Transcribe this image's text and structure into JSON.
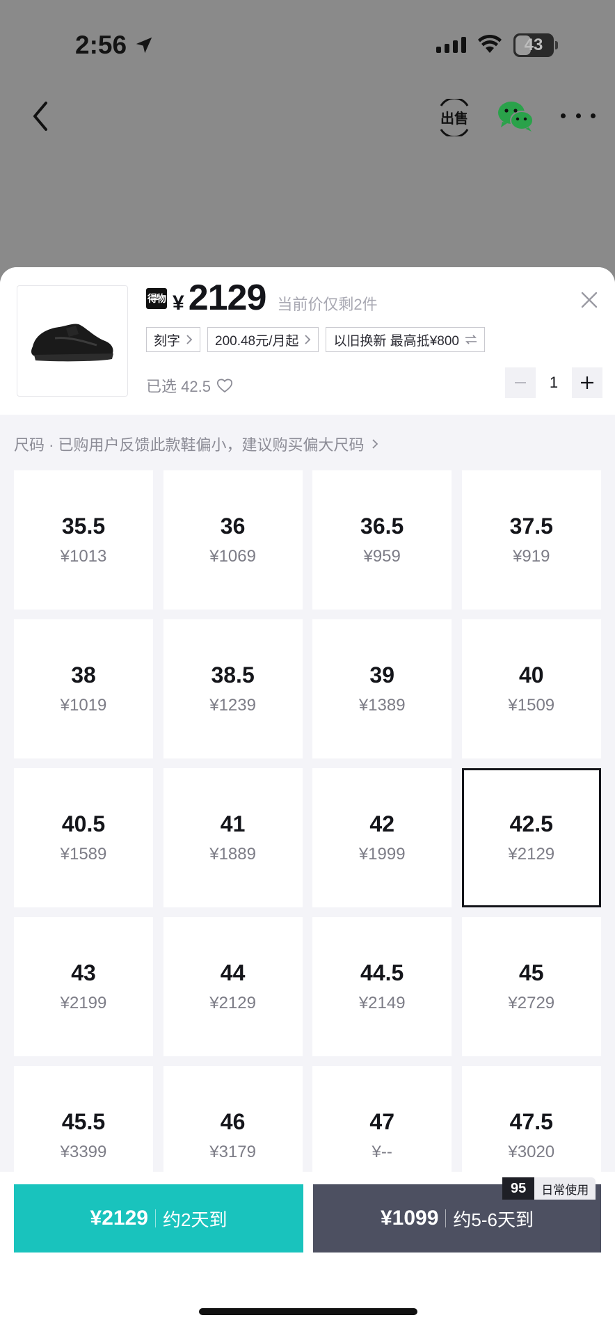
{
  "status_bar": {
    "time": "2:56",
    "battery": "43",
    "battery_level": 0.43
  },
  "nav": {
    "back": "back-icon",
    "sell_label": "出售",
    "share": "wechat-icon",
    "more": "more-icon"
  },
  "product": {
    "brand_badge": "得物",
    "currency": "¥",
    "price": "2129",
    "stock_note": "当前价仅剩2件",
    "tags": [
      {
        "label": "刻字",
        "chevron": true
      },
      {
        "label": "200.48元/月起",
        "chevron": true
      },
      {
        "label": "以旧换新 最高抵¥800",
        "chevron": false,
        "swap": true
      }
    ],
    "selected_text": "已选 42.5",
    "quantity": "1"
  },
  "size_hint": "尺码 · 已购用户反馈此款鞋偏小，建议购买偏大尺码",
  "sizes": [
    {
      "size": "35.5",
      "price": "¥1013"
    },
    {
      "size": "36",
      "price": "¥1069"
    },
    {
      "size": "36.5",
      "price": "¥959"
    },
    {
      "size": "37.5",
      "price": "¥919"
    },
    {
      "size": "38",
      "price": "¥1019"
    },
    {
      "size": "38.5",
      "price": "¥1239"
    },
    {
      "size": "39",
      "price": "¥1389"
    },
    {
      "size": "40",
      "price": "¥1509"
    },
    {
      "size": "40.5",
      "price": "¥1589"
    },
    {
      "size": "41",
      "price": "¥1889"
    },
    {
      "size": "42",
      "price": "¥1999"
    },
    {
      "size": "42.5",
      "price": "¥2129",
      "selected": true
    },
    {
      "size": "43",
      "price": "¥2199"
    },
    {
      "size": "44",
      "price": "¥2129"
    },
    {
      "size": "44.5",
      "price": "¥2149"
    },
    {
      "size": "45",
      "price": "¥2729"
    },
    {
      "size": "45.5",
      "price": "¥3399"
    },
    {
      "size": "46",
      "price": "¥3179"
    },
    {
      "size": "47",
      "price": "¥--"
    },
    {
      "size": "47.5",
      "price": "¥3020"
    }
  ],
  "buy_fast": {
    "price": "¥2129",
    "eta": "约2天到",
    "color": "#19c3bd"
  },
  "buy_slow": {
    "price": "¥1099",
    "eta": "约5-6天到",
    "color": "#4d5061",
    "badge_num": "95",
    "badge_text": "日常使用"
  }
}
